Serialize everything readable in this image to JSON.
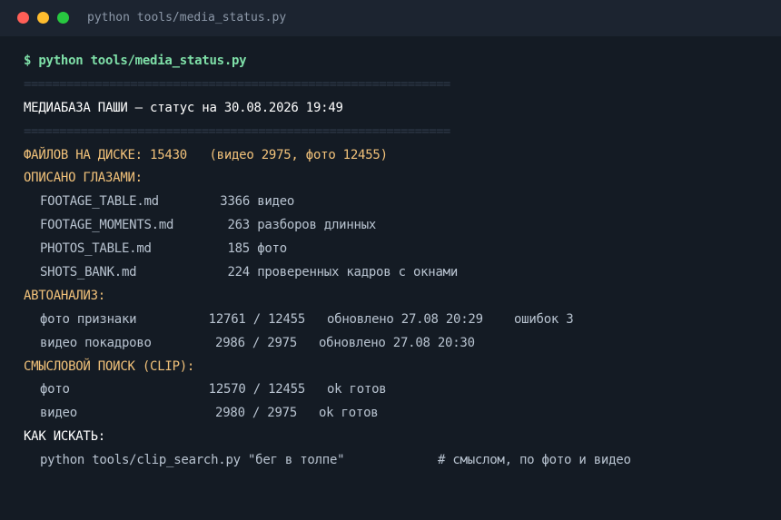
{
  "window": {
    "title": "python tools/media_status.py"
  },
  "prompt": "$ python tools/media_status.py",
  "rule": "============================================================",
  "header": "МЕДИАБАЗА ПАШИ — статус на 30.08.2026 19:49",
  "files_line": "ФАЙЛОВ НА ДИСКЕ: 15430   (видео 2975, фото 12455)",
  "described": {
    "title": "ОПИСАНО ГЛАЗАМИ:",
    "rows": [
      {
        "name": "FOOTAGE_TABLE.md",
        "count": "3366",
        "desc": "видео"
      },
      {
        "name": "FOOTAGE_MOMENTS.md",
        "count": "263",
        "desc": "разборов длинных"
      },
      {
        "name": "PHOTOS_TABLE.md",
        "count": "185",
        "desc": "фото"
      },
      {
        "name": "SHOTS_BANK.md",
        "count": "224",
        "desc": "проверенных кадров с окнами"
      }
    ]
  },
  "autoanalysis": {
    "title": "АВТОАНАЛИЗ:",
    "rows": [
      {
        "name": "фото признаки",
        "ratio": "12761 / 12455",
        "updated": "обновлено 27.08 20:29",
        "extra": "ошибок 3"
      },
      {
        "name": "видео покадрово",
        "ratio": "2986 / 2975",
        "updated": "обновлено 27.08 20:30",
        "extra": ""
      }
    ]
  },
  "clip": {
    "title": "СМЫСЛОВОЙ ПОИСК (CLIP):",
    "rows": [
      {
        "name": "фото",
        "ratio": "12570 / 12455",
        "status": "ok готов"
      },
      {
        "name": "видео",
        "ratio": "2980 / 2975",
        "status": "ok готов"
      }
    ]
  },
  "howto": {
    "title": "КАК ИСКАТЬ:",
    "command": "python tools/clip_search.py \"бег в толпе\"",
    "comment": "# смыслом, по фото и видео"
  },
  "colors": {
    "background": "#141b24",
    "titlebar": "#1c2430",
    "prompt": "#7fe0a8",
    "section": "#f2c27a",
    "text": "#c9d3df"
  }
}
